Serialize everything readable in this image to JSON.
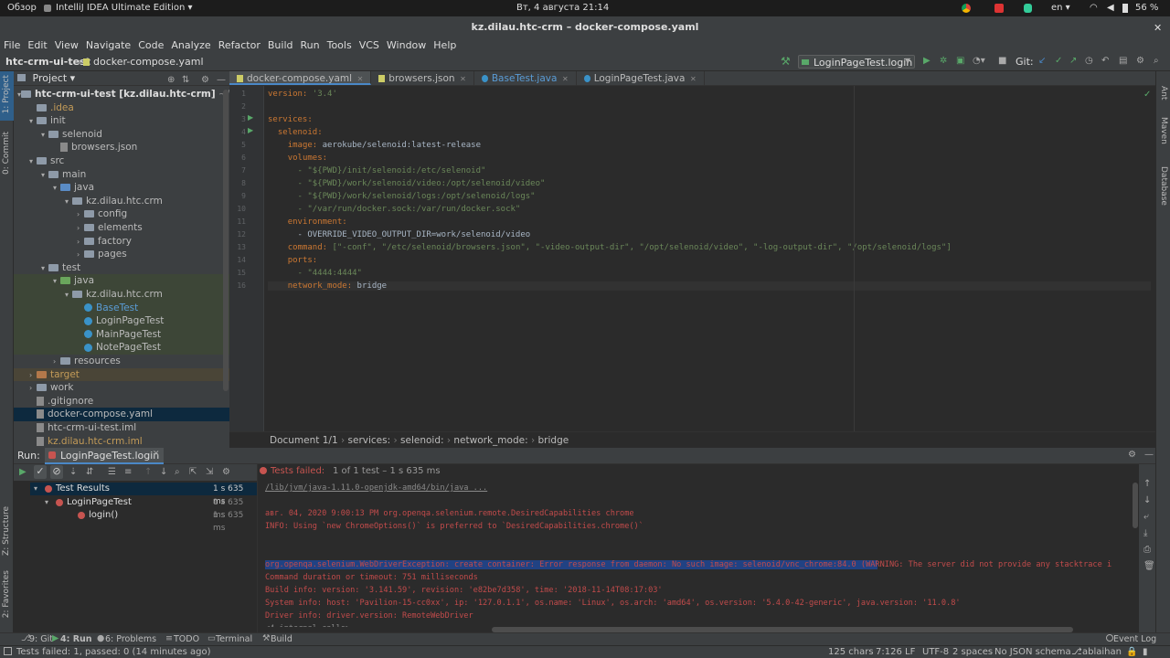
{
  "gnome": {
    "activities": "Обзор",
    "app": "IntelliJ IDEA Ultimate Edition ▾",
    "clock": "Вт, 4 августа  21:14",
    "lang": "en ▾",
    "battery": "56 %"
  },
  "window_title": "kz.dilau.htc-crm – docker-compose.yaml",
  "menu": [
    "File",
    "Edit",
    "View",
    "Navigate",
    "Code",
    "Analyze",
    "Refactor",
    "Build",
    "Run",
    "Tools",
    "VCS",
    "Window",
    "Help"
  ],
  "nav": {
    "project": "htc-crm-ui-test",
    "file": "docker-compose.yaml",
    "run_config": "LoginPageTest.login",
    "git_label": "Git:"
  },
  "left_strip": {
    "project": "1: Project",
    "commit": "0: Commit",
    "structure": "Z: Structure",
    "favorites": "2: Favorites"
  },
  "right_strip": {
    "ant": "Ant",
    "maven": "Maven",
    "database": "Database"
  },
  "project_panel": {
    "title": "Project ▾",
    "root_name": "htc-crm-ui-test [kz.dilau.htc-crm]",
    "root_path": " ~/Tests/C",
    "items": [
      {
        "label": ".idea",
        "color": "#c39b58"
      },
      {
        "label": "init"
      },
      {
        "label": "selenoid"
      },
      {
        "label": "browsers.json"
      },
      {
        "label": "src"
      },
      {
        "label": "main"
      },
      {
        "label": "java"
      },
      {
        "label": "kz.dilau.htc.crm"
      },
      {
        "label": "config"
      },
      {
        "label": "elements"
      },
      {
        "label": "factory"
      },
      {
        "label": "pages"
      },
      {
        "label": "test"
      },
      {
        "label": "java"
      },
      {
        "label": "kz.dilau.htc.crm"
      },
      {
        "label": "BaseTest",
        "color": "#5a9cd6"
      },
      {
        "label": "LoginPageTest"
      },
      {
        "label": "MainPageTest"
      },
      {
        "label": "NotePageTest"
      },
      {
        "label": "resources"
      },
      {
        "label": "target",
        "color": "#c39b58"
      },
      {
        "label": "work"
      },
      {
        "label": ".gitignore"
      },
      {
        "label": "docker-compose.yaml"
      },
      {
        "label": "htc-crm-ui-test.iml"
      },
      {
        "label": "kz.dilau.htc-crm.iml",
        "color": "#c39b58"
      }
    ]
  },
  "tabs": [
    "docker-compose.yaml",
    "browsers.json",
    "BaseTest.java",
    "LoginPageTest.java"
  ],
  "code_lines": [
    "version: '3.4'",
    "",
    "services:",
    "  selenoid:",
    "    image: aerokube/selenoid:latest-release",
    "    volumes:",
    "      - \"${PWD}/init/selenoid:/etc/selenoid\"",
    "      - \"${PWD}/work/selenoid/video:/opt/selenoid/video\"",
    "      - \"${PWD}/work/selenoid/logs:/opt/selenoid/logs\"",
    "      - \"/var/run/docker.sock:/var/run/docker.sock\"",
    "    environment:",
    "      - OVERRIDE_VIDEO_OUTPUT_DIR=work/selenoid/video",
    "    command: [\"-conf\", \"/etc/selenoid/browsers.json\", \"-video-output-dir\", \"/opt/selenoid/video\", \"-log-output-dir\", \"/opt/selenoid/logs\"]",
    "    ports:",
    "      - \"4444:4444\"",
    "    network_mode: bridge"
  ],
  "breadcrumbs": [
    "Document 1/1",
    "services:",
    "selenoid:",
    "network_mode:",
    "bridge"
  ],
  "run": {
    "label": "Run:",
    "tab": "LoginPageTest.login",
    "status": "Tests failed:",
    "status_detail": " 1 of 1 test – 1 s 635 ms",
    "tree": [
      {
        "label": "Test Results",
        "time": "1 s 635 ms"
      },
      {
        "label": "LoginPageTest",
        "time": "1 s 635 ms"
      },
      {
        "label": "login()",
        "time": "1 s 635 ms"
      }
    ],
    "console": [
      "/lib/jvm/java-1.11.0-openjdk-amd64/bin/java ...",
      "",
      "авг. 04, 2020 9:00:13 PM org.openqa.selenium.remote.DesiredCapabilities chrome",
      "INFO: Using `new ChromeOptions()` is preferred to `DesiredCapabilities.chrome()`",
      "",
      "",
      "org.openqa.selenium.WebDriverException: create container: Error response from daemon: No such image: selenoid/vnc_chrome:84.0 (WARNING: The server did not provide any stacktrace i",
      "Command duration or timeout: 751 milliseconds",
      "Build info: version: '3.141.59', revision: 'e82be7d358', time: '2018-11-14T08:17:03'",
      "System info: host: 'Pavilion-15-cc0xx', ip: '127.0.1.1', os.name: 'Linux', os.arch: 'amd64', os.version: '5.4.0-42-generic', java.version: '11.0.8'",
      "Driver info: driver.version: RemoteWebDriver",
      "<4 internal calls>"
    ]
  },
  "bottom_tabs": [
    "9: Git",
    "4: Run",
    "6: Problems",
    "TODO",
    "Terminal",
    "Build"
  ],
  "event_log": "Event Log",
  "statusbar": {
    "message": "Tests failed: 1, passed: 0 (14 minutes ago)",
    "chars": "125 chars",
    "pos": "7:126",
    "lf": "LF",
    "enc": "UTF-8",
    "indent": "2 spaces",
    "schema": "No JSON schema",
    "user": "ablaihan"
  },
  "colors": {
    "accent": "#4a88c7",
    "error": "#c75450",
    "success": "#59a869"
  }
}
